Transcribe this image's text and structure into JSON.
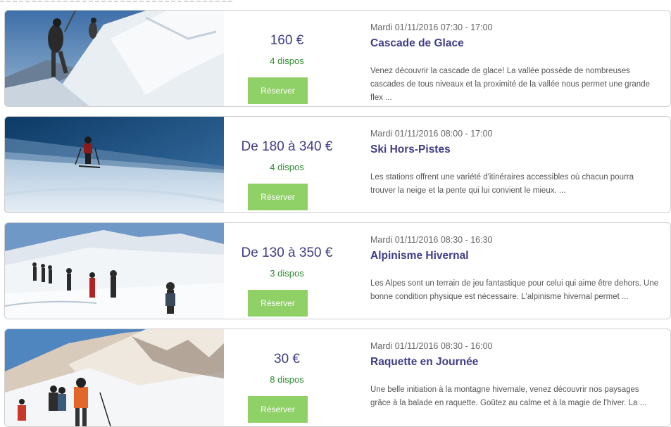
{
  "activities": [
    {
      "photo": "ice-climbing-photo",
      "price": "160 €",
      "dispos": "4 dispos",
      "button": "Réserver",
      "date": "Mardi 01/11/2016 07:30 - 17:00",
      "title": "Cascade de Glace",
      "description": "Venez découvrir la cascade de glace! La vallée possède de nombreuses cascades de tous niveaux et la proximité de la vallée nous permet une grande flex ..."
    },
    {
      "photo": "off-piste-ski-photo",
      "price": "De 180 à 340 €",
      "dispos": "4 dispos",
      "button": "Réserver",
      "date": "Mardi 01/11/2016 08:00 - 17:00",
      "title": "Ski Hors-Pistes",
      "description": "Les stations offrent une variété d'itinéraires accessibles où chacun pourra trouver la neige et la pente qui lui convient le mieux. ..."
    },
    {
      "photo": "winter-mountaineering-photo",
      "price": "De 130 à 350 €",
      "dispos": "3 dispos",
      "button": "Réserver",
      "date": "Mardi 01/11/2016 08:30 - 16:30",
      "title": "Alpinisme Hivernal",
      "description": "Les Alpes sont un terrain de jeu fantastique pour celui qui aime être dehors. Une bonne condition physique est nécessaire. L'alpinisme hivernal permet ..."
    },
    {
      "photo": "snowshoe-day-photo",
      "price": "30 €",
      "dispos": "8 dispos",
      "button": "Réserver",
      "date": "Mardi 01/11/2016 08:30 - 16:00",
      "title": "Raquette en Journée",
      "description": "Une belle initiation à la montagne hivernale, venez découvrir nos paysages grâce à la balade en raquette. Goûtez au calme et à la magie de l'hiver. La ..."
    }
  ],
  "colors": {
    "title": "#3f3d86",
    "price": "#3f3d86",
    "dispos": "#2e8b2e",
    "button_bg": "#8fd067",
    "button_text": "#ffffff",
    "border": "#cfcfcf"
  }
}
